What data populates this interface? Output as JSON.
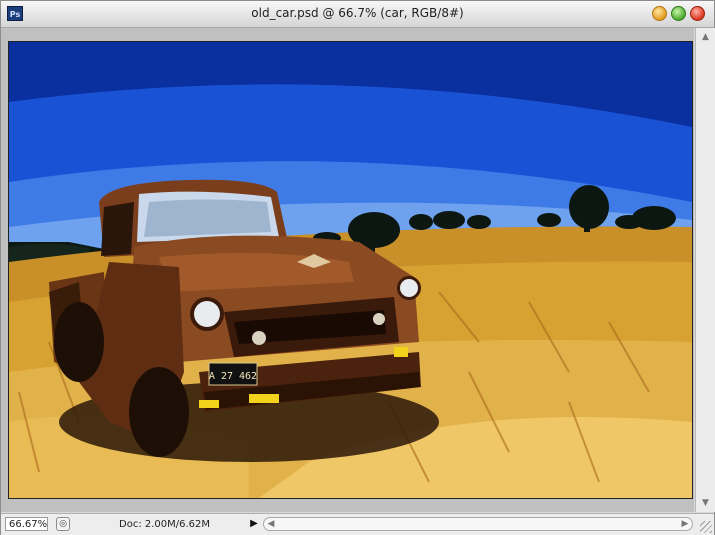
{
  "window": {
    "title": "old_car.psd @ 66.7% (car, RGB/8#)",
    "app_icon_label": "Ps",
    "controls": [
      "minimize-icon",
      "maximize-icon",
      "close-icon"
    ]
  },
  "canvas": {
    "plate_text": "A 27 462",
    "colors": {
      "sky_dark": "#0a2f9e",
      "sky_mid": "#1a52d6",
      "sky_light": "#5e95ea",
      "field": "#d8a232",
      "truck_rust": "#8a4a22"
    }
  },
  "status": {
    "zoom": "66.67%",
    "doc_info": "Doc: 2.00M/6.62M",
    "menu_arrow": "▶"
  },
  "scrollbars": {
    "up": "▲",
    "down": "▼",
    "left": "◀",
    "right": "▶"
  }
}
